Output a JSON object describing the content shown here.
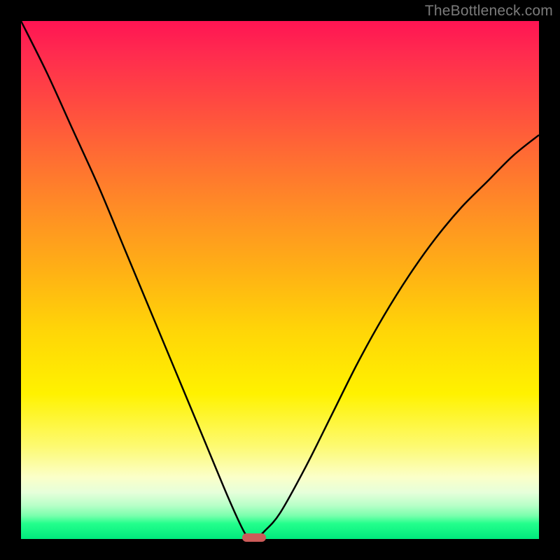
{
  "watermark": "TheBottleneck.com",
  "colors": {
    "frame": "#000000",
    "watermark": "#7b7b7b",
    "curve": "#000000",
    "marker": "#cc5b59"
  },
  "chart_data": {
    "type": "line",
    "title": "",
    "xlabel": "",
    "ylabel": "",
    "xlim": [
      0,
      100
    ],
    "ylim": [
      0,
      100
    ],
    "grid": false,
    "legend": false,
    "note": "V-shaped bottleneck curve; values are percentage deviation. Axes are unlabeled in the source image; values estimated from geometry.",
    "series": [
      {
        "name": "bottleneck-curve",
        "x": [
          0,
          5,
          10,
          15,
          20,
          25,
          30,
          35,
          40,
          43,
          44,
          45,
          46,
          47,
          50,
          55,
          60,
          65,
          70,
          75,
          80,
          85,
          90,
          95,
          100
        ],
        "values": [
          100,
          90,
          79,
          68,
          56,
          44,
          32,
          20,
          8,
          1.5,
          0.6,
          0,
          0.6,
          1.5,
          5,
          14,
          24,
          34,
          43,
          51,
          58,
          64,
          69,
          74,
          78
        ]
      }
    ],
    "annotations": [
      {
        "name": "min-marker",
        "x": 45,
        "y": 0,
        "shape": "rounded-rect"
      }
    ],
    "gradient_stops": [
      {
        "pos": 0.0,
        "color": "#ff1453"
      },
      {
        "pos": 0.72,
        "color": "#fff200"
      },
      {
        "pos": 1.0,
        "color": "#00ea7d"
      }
    ]
  }
}
